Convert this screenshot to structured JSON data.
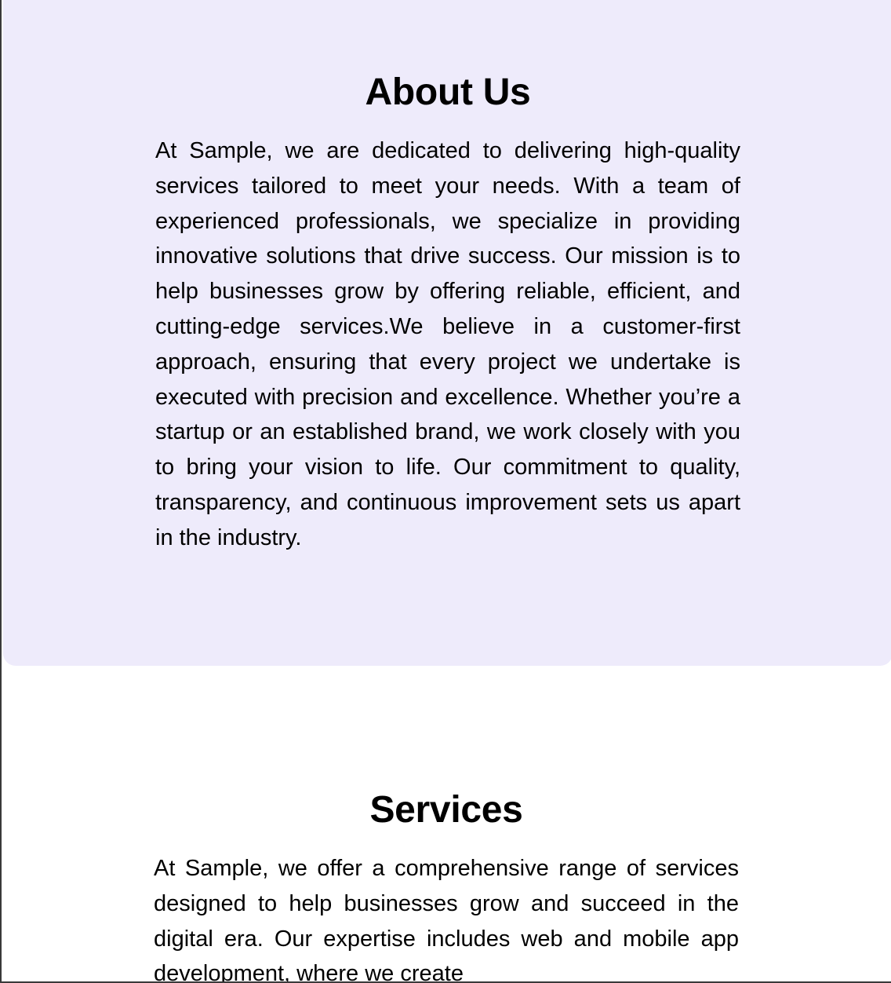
{
  "about": {
    "title": "About Us",
    "body": "At Sample, we are dedicated to delivering high-quality services tailored to meet your needs. With a team of experienced professionals, we specialize in providing innovative solutions that drive success. Our mission is to help businesses grow by offering reliable, efficient, and cutting-edge services.We believe in a customer-first approach, ensuring that every project we undertake is executed with precision and excellence. Whether you’re a startup or an established brand, we work closely with you to bring your vision to life. Our commitment to quality, transparency, and continuous improvement sets us apart in the industry."
  },
  "services": {
    "title": "Services",
    "body": "At Sample, we offer a comprehensive range of services designed to help businesses grow and succeed in the digital era. Our expertise includes web and mobile app development, where we create"
  },
  "colors": {
    "about_background": "#eeebfb",
    "page_background": "#ffffff",
    "text": "#000000"
  }
}
